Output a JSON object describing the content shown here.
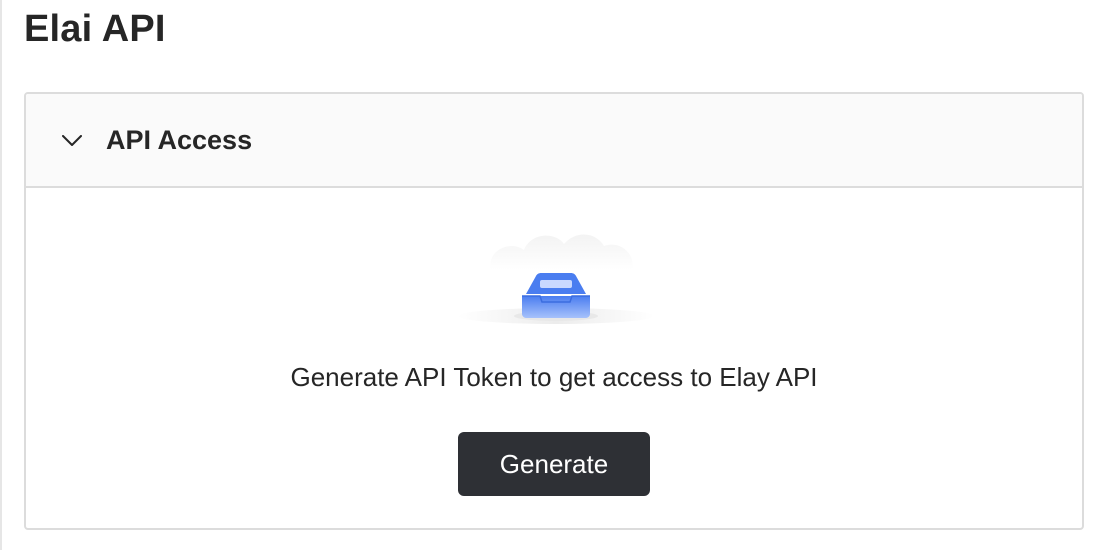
{
  "page": {
    "title": "Elai API"
  },
  "panel": {
    "title": "API Access",
    "expanded": true,
    "toggle_icon": "chevron-down-icon",
    "empty_state": {
      "illustration_icon": "empty-inbox-icon",
      "message": "Generate API Token to get access to Elay API",
      "button_label": "Generate"
    }
  },
  "colors": {
    "button_bg": "#2e3035",
    "button_text": "#ffffff",
    "header_bg": "#fafafa",
    "border": "#dcdcdc",
    "illustration_accent": "#4a7df0"
  }
}
